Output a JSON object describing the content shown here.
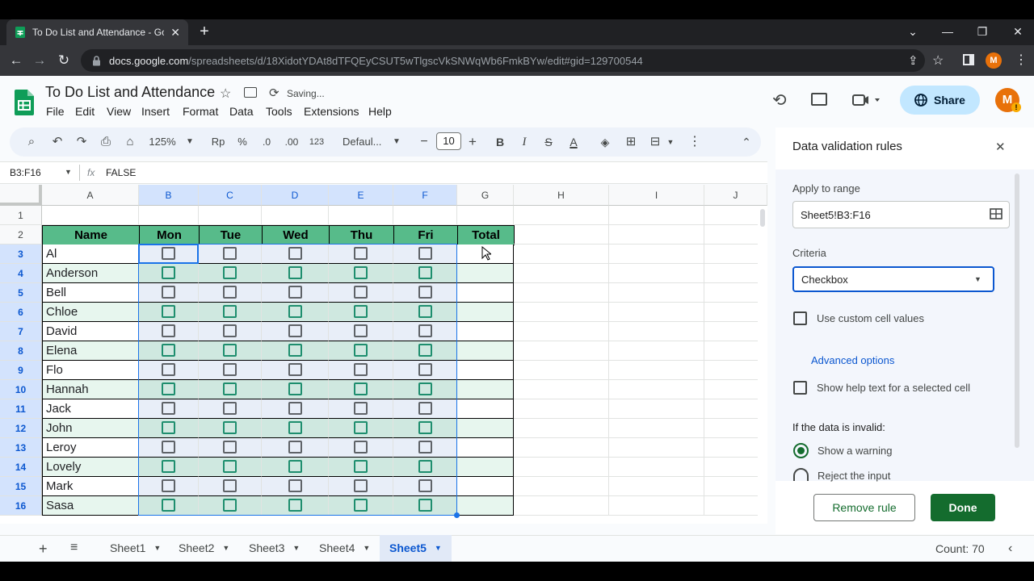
{
  "browser": {
    "tab_title": "To Do List and Attendance - Goo",
    "url_host": "docs.google.com",
    "url_path": "/spreadsheets/d/18XidotYDAt8dTFQEyCSUT5wTlgscVkSNWqWb6FmkBYw/edit#gid=129700544",
    "profile_initial": "M"
  },
  "doc": {
    "title": "To Do List and Attendance",
    "status": "Saving...",
    "menus": [
      "File",
      "Edit",
      "View",
      "Insert",
      "Format",
      "Data",
      "Tools",
      "Extensions",
      "Help"
    ],
    "share_label": "Share",
    "avatar_initial": "M"
  },
  "toolbar": {
    "zoom": "125%",
    "currency": "Rp",
    "percent": "%",
    "dec_decrease": ".0",
    "dec_increase": ".00",
    "number_format": "123",
    "font": "Defaul...",
    "font_size": "10",
    "bold": "B",
    "italic": "I",
    "strike": "S",
    "text_color": "A"
  },
  "formula_bar": {
    "name_box": "B3:F16",
    "fx": "fx",
    "value": "FALSE"
  },
  "grid": {
    "columns": [
      "A",
      "B",
      "C",
      "D",
      "E",
      "F",
      "G",
      "H",
      "I",
      "J"
    ],
    "row_numbers": [
      "1",
      "2",
      "3",
      "4",
      "5",
      "6",
      "7",
      "8",
      "9",
      "10",
      "11",
      "12",
      "13",
      "14",
      "15",
      "16"
    ],
    "header_row": [
      "Name",
      "Mon",
      "Tue",
      "Wed",
      "Thu",
      "Fri",
      "Total"
    ],
    "names": [
      "Al",
      "Anderson",
      "Bell",
      "Chloe",
      "David",
      "Elena",
      "Flo",
      "Hannah",
      "Jack",
      "John",
      "Leroy",
      "Lovely",
      "Mark",
      "Sasa"
    ],
    "row_fill_colors": [
      "#ffffff",
      "#e7f6ee"
    ],
    "checkbox_colors": {
      "odd": "#5f6368",
      "even": "#1e8e6e"
    }
  },
  "sheets": {
    "tabs": [
      "Sheet1",
      "Sheet2",
      "Sheet3",
      "Sheet4",
      "Sheet5"
    ],
    "active": "Sheet5",
    "count": "Count: 70"
  },
  "panel": {
    "title": "Data validation rules",
    "apply_label": "Apply to range",
    "range_value": "Sheet5!B3:F16",
    "criteria_label": "Criteria",
    "criteria_value": "Checkbox",
    "custom_values_label": "Use custom cell values",
    "advanced_label": "Advanced options",
    "help_text_label": "Show help text for a selected cell",
    "invalid_label": "If the data is invalid:",
    "option_warning": "Show a warning",
    "option_reject": "Reject the input",
    "remove_label": "Remove rule",
    "done_label": "Done"
  },
  "colors": {
    "accent": "#0b57d0",
    "done_button": "#146c2e",
    "header_green": "#57bb8a",
    "share_bg": "#c2e7ff"
  }
}
